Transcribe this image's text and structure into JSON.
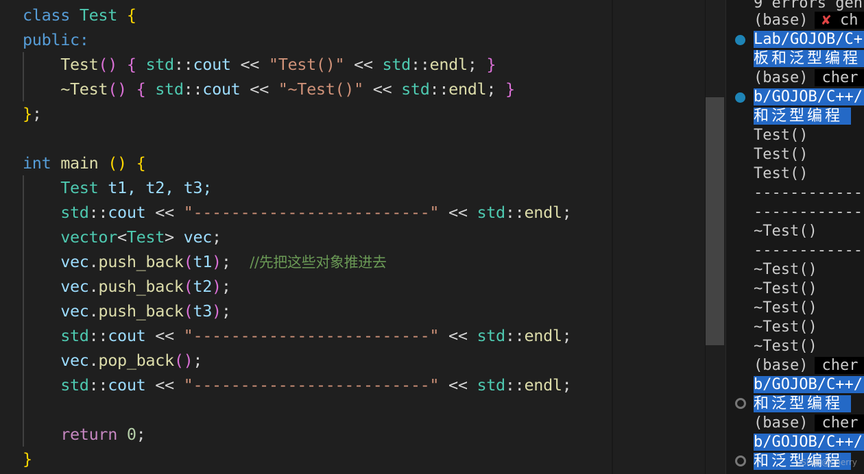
{
  "editor": {
    "lines": [
      {
        "kw": "class",
        "type": "Test",
        "brace": "{"
      },
      {
        "kw": "public:"
      },
      {
        "fn": "Test",
        "str": "\"Test()\""
      },
      {
        "fn": "~Test",
        "str": "\"~Test()\""
      },
      {
        "text": "};"
      },
      {
        "text": ""
      },
      {
        "kw": "int",
        "fn": "main",
        "paren": "()",
        "brace": "{"
      },
      {
        "type": "Test",
        "vars": "t1, t2, t3;"
      },
      {
        "str": "\"-------------------------\""
      },
      {
        "type1": "vector",
        "type2": "Test",
        "var": "vec"
      },
      {
        "var": "vec",
        "fn": "push_back",
        "arg": "t1",
        "comment": "//先把这些对象推进去"
      },
      {
        "var": "vec",
        "fn": "push_back",
        "arg": "t2"
      },
      {
        "var": "vec",
        "fn": "push_back",
        "arg": "t3"
      },
      {
        "str": "\"-------------------------\""
      },
      {
        "var": "vec",
        "fn": "pop_back"
      },
      {
        "str": "\"-------------------------\""
      },
      {
        "text": ""
      },
      {
        "ctrl": "return",
        "num": "0"
      },
      {
        "text": "}"
      }
    ],
    "tokens": {
      "std": "std",
      "cout": "cout",
      "endl": "endl",
      "shift": "<<"
    }
  },
  "terminal": {
    "lines": [
      {
        "text": "9 errors gen"
      },
      {
        "prefix": "(base)",
        "error_mark": "✘",
        "prompt": "ch"
      },
      {
        "path": "Lab/GOJOB/C+",
        "marker": "filled"
      },
      {
        "path_cjk": "板和泛型编程"
      },
      {
        "prefix": "(base)",
        "prompt": "cher"
      },
      {
        "path": "b/GOJOB/C++/",
        "marker": "filled"
      },
      {
        "path_cjk": "和泛型编程"
      },
      {
        "text": "Test()"
      },
      {
        "text": "Test()"
      },
      {
        "text": "Test()"
      },
      {
        "text": "------------"
      },
      {
        "text": "------------"
      },
      {
        "text": "~Test()"
      },
      {
        "text": "------------"
      },
      {
        "text": "~Test()"
      },
      {
        "text": "~Test()"
      },
      {
        "text": "~Test()"
      },
      {
        "text": "~Test()"
      },
      {
        "text": "~Test()"
      },
      {
        "prefix": "(base)",
        "prompt": "cher"
      },
      {
        "path": "b/GOJOB/C++/"
      },
      {
        "path_cjk": "和泛型编程",
        "marker": "hollow"
      },
      {
        "prefix": "(base)",
        "prompt": "cher"
      },
      {
        "path": "b/GOJOB/C++/"
      },
      {
        "path_cjk": "和泛型编程",
        "marker": "hollow"
      }
    ]
  },
  "watermark": "CSDN @Cherry",
  "colors": {
    "editor_bg": "#1f1f1f",
    "terminal_bg": "#181818",
    "selection": "#2469c6",
    "keyword": "#569cd6",
    "type": "#4ec9b0",
    "function": "#dcdcaa",
    "string": "#ce9178",
    "variable": "#9cdcfe",
    "comment": "#6a9955",
    "control": "#c586c0",
    "number": "#b5cea8"
  }
}
